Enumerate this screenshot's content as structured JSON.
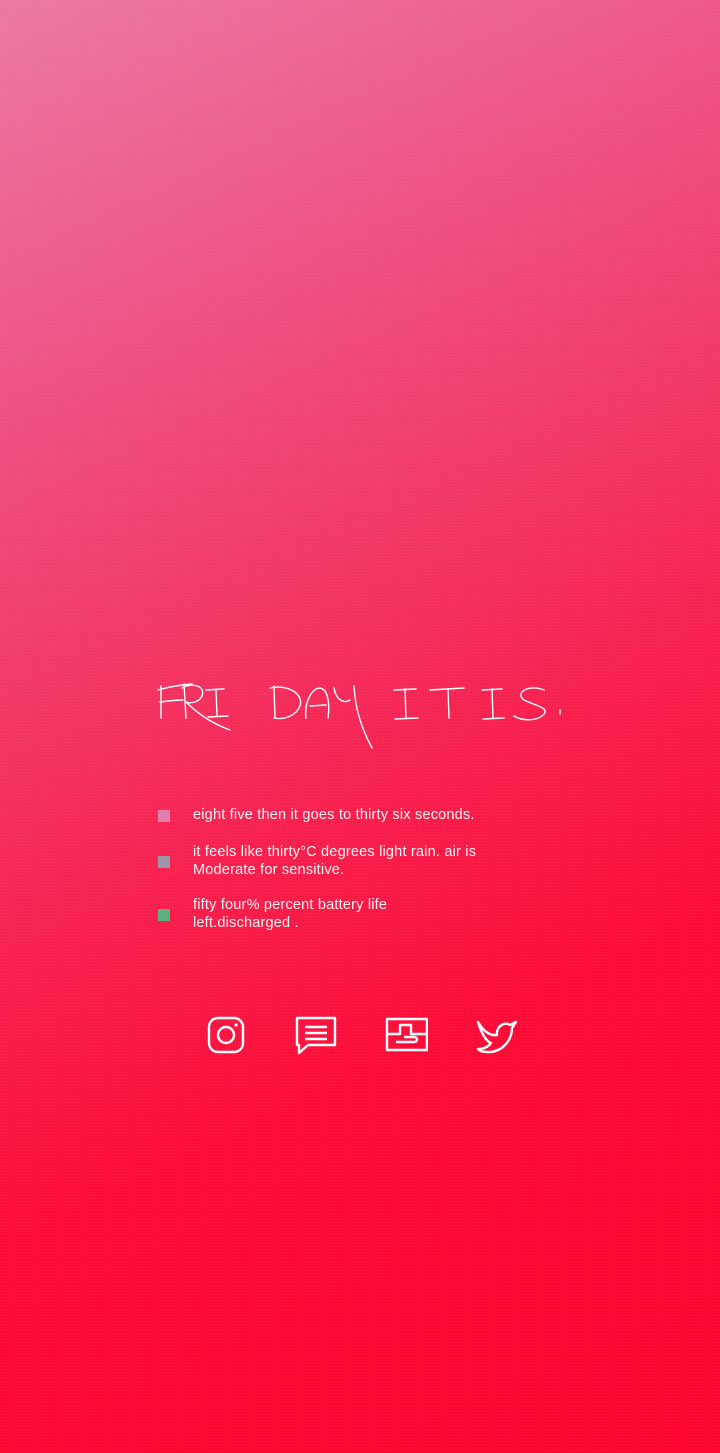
{
  "headline": {
    "text": "FRI DAY IT IS."
  },
  "info": {
    "items": [
      {
        "text": "eight five then it goes to thirty six seconds.",
        "bullet_color": "#e07fae"
      },
      {
        "text": "it feels like thirty°C degrees light rain. air is Moderate for sensitive.",
        "bullet_color": "#9e96a8"
      },
      {
        "text": "fifty four% percent battery life left.discharged .",
        "bullet_color": "#5db07f"
      }
    ]
  },
  "apps": {
    "icons": [
      "instagram-icon",
      "messages-icon",
      "mail-icon",
      "twitter-icon"
    ]
  },
  "colors": {
    "gradient_top": "#ec78a6",
    "gradient_bottom": "#ff0530",
    "text": "#fff3f6"
  }
}
